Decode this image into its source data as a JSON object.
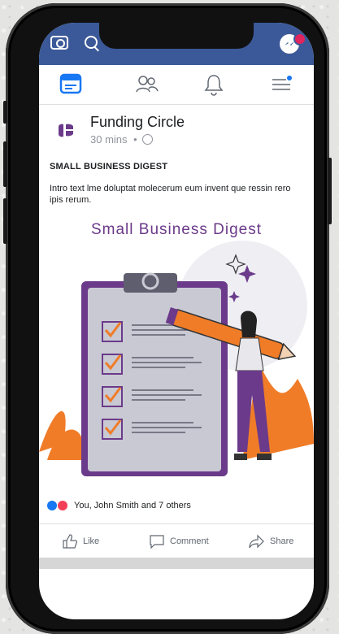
{
  "header": {
    "accent": "#3b5998"
  },
  "nav": {
    "items": [
      "home-icon",
      "friends-icon",
      "notifications-icon",
      "menu-icon"
    ]
  },
  "post": {
    "page_name": "Funding Circle",
    "time": "30 mins",
    "separator": "•",
    "heading": "SMALL BUSINESS DIGEST",
    "body": "Intro text lme doluptat molecerum eum invent que ressin rero ipis rerum.",
    "image_title": "Small Business Digest",
    "reactions_text": "You, John Smith and 7 others"
  },
  "actions": {
    "like": "Like",
    "comment": "Comment",
    "share": "Share"
  },
  "colors": {
    "brand_purple": "#6b3a8a",
    "orange": "#f07c28"
  }
}
